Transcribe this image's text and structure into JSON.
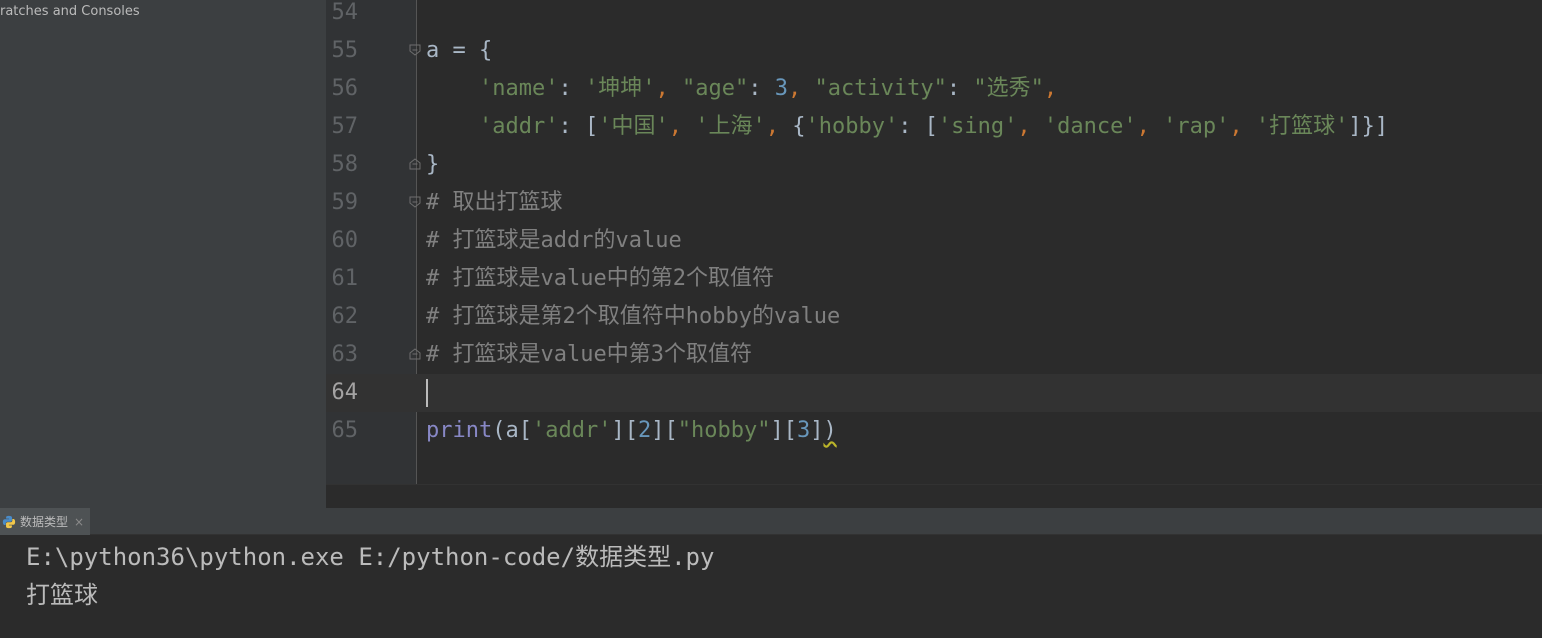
{
  "project_panel": {
    "scratches_label": "ratches and Consoles"
  },
  "editor": {
    "lines": [
      {
        "number": "54",
        "tokens": []
      },
      {
        "number": "55",
        "fold": "start",
        "tokens": [
          {
            "t": "a = {",
            "c": "t-txt"
          }
        ]
      },
      {
        "number": "56",
        "tokens": [
          {
            "t": "    ",
            "c": "t-txt"
          },
          {
            "t": "'name'",
            "c": "t-str"
          },
          {
            "t": ": ",
            "c": "t-txt"
          },
          {
            "t": "'坤坤'",
            "c": "t-str"
          },
          {
            "t": ", ",
            "c": "t-punc"
          },
          {
            "t": "\"age\"",
            "c": "t-str"
          },
          {
            "t": ": ",
            "c": "t-txt"
          },
          {
            "t": "3",
            "c": "t-num"
          },
          {
            "t": ", ",
            "c": "t-punc"
          },
          {
            "t": "\"activity\"",
            "c": "t-str"
          },
          {
            "t": ": ",
            "c": "t-txt"
          },
          {
            "t": "\"选秀\"",
            "c": "t-str"
          },
          {
            "t": ",",
            "c": "t-punc"
          }
        ]
      },
      {
        "number": "57",
        "tokens": [
          {
            "t": "    ",
            "c": "t-txt"
          },
          {
            "t": "'addr'",
            "c": "t-str"
          },
          {
            "t": ": [",
            "c": "t-txt"
          },
          {
            "t": "'中国'",
            "c": "t-str"
          },
          {
            "t": ", ",
            "c": "t-punc"
          },
          {
            "t": "'上海'",
            "c": "t-str"
          },
          {
            "t": ", ",
            "c": "t-punc"
          },
          {
            "t": "{",
            "c": "t-txt"
          },
          {
            "t": "'hobby'",
            "c": "t-str"
          },
          {
            "t": ": [",
            "c": "t-txt"
          },
          {
            "t": "'sing'",
            "c": "t-str"
          },
          {
            "t": ", ",
            "c": "t-punc"
          },
          {
            "t": "'dance'",
            "c": "t-str"
          },
          {
            "t": ", ",
            "c": "t-punc"
          },
          {
            "t": "'rap'",
            "c": "t-str"
          },
          {
            "t": ", ",
            "c": "t-punc"
          },
          {
            "t": "'打篮球'",
            "c": "t-str"
          },
          {
            "t": "]}]",
            "c": "t-txt"
          }
        ]
      },
      {
        "number": "58",
        "fold": "end",
        "tokens": [
          {
            "t": "}",
            "c": "t-txt"
          }
        ]
      },
      {
        "number": "59",
        "fold": "start",
        "tokens": [
          {
            "t": "# 取出打篮球",
            "c": "t-cmt"
          }
        ]
      },
      {
        "number": "60",
        "tokens": [
          {
            "t": "# 打篮球是addr的value",
            "c": "t-cmt"
          }
        ]
      },
      {
        "number": "61",
        "tokens": [
          {
            "t": "# 打篮球是value中的第2个取值符",
            "c": "t-cmt"
          }
        ]
      },
      {
        "number": "62",
        "tokens": [
          {
            "t": "# 打篮球是第2个取值符中hobby的value",
            "c": "t-cmt"
          }
        ]
      },
      {
        "number": "63",
        "fold": "end",
        "tokens": [
          {
            "t": "# 打篮球是value中第3个取值符",
            "c": "t-cmt"
          }
        ]
      },
      {
        "number": "64",
        "current": true,
        "tokens": []
      },
      {
        "number": "65",
        "tokens": [
          {
            "t": "print",
            "c": "t-builtin"
          },
          {
            "t": "(a[",
            "c": "t-txt"
          },
          {
            "t": "'addr'",
            "c": "t-str"
          },
          {
            "t": "][",
            "c": "t-txt"
          },
          {
            "t": "2",
            "c": "t-num"
          },
          {
            "t": "][",
            "c": "t-txt"
          },
          {
            "t": "\"hobby\"",
            "c": "t-str"
          },
          {
            "t": "][",
            "c": "t-txt"
          },
          {
            "t": "3",
            "c": "t-num"
          },
          {
            "t": "]",
            "c": "t-txt"
          },
          {
            "t": ")",
            "c": "t-txt",
            "squiggle": true
          }
        ]
      }
    ]
  },
  "run_panel": {
    "tab_label": "数据类型",
    "close_glyph": "×",
    "console_lines": [
      "E:\\python36\\python.exe E:/python-code/数据类型.py",
      "打篮球"
    ]
  },
  "colors": {
    "string": "#6a8759",
    "number": "#6897bb",
    "punctuation": "#cc7832",
    "comment": "#808080",
    "builtin": "#8888c6",
    "text": "#a9b7c6"
  }
}
